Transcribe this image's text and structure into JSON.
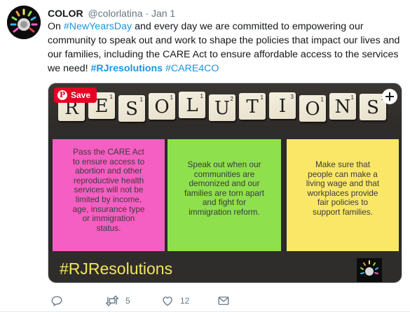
{
  "tweet": {
    "author_name": "COLOR",
    "handle": "@colorlatina",
    "separator": "·",
    "date": "Jan 1",
    "text": {
      "part1": "On ",
      "tag1": "#NewYearsDay",
      "part2": " and every day we are committed to empowering our community to speak out and work to shape the policies that impact our lives and our families, including the CARE Act to ensure affordable access to the services we need! ",
      "tag2": "#RJresolutions",
      "part3": " ",
      "tag3": "#CARE4CO"
    }
  },
  "image": {
    "save_label": "Save",
    "pin_logo": "P",
    "tiles": [
      {
        "letter": "R",
        "score": "1"
      },
      {
        "letter": "E",
        "score": "1"
      },
      {
        "letter": "S",
        "score": "1"
      },
      {
        "letter": "O",
        "score": "1"
      },
      {
        "letter": "L",
        "score": "1"
      },
      {
        "letter": "U",
        "score": "2"
      },
      {
        "letter": "T",
        "score": "1"
      },
      {
        "letter": "I",
        "score": "3"
      },
      {
        "letter": "O",
        "score": "1"
      },
      {
        "letter": "N",
        "score": "1"
      },
      {
        "letter": "S",
        "score": "1"
      }
    ],
    "notes": {
      "pink": "Pass the CARE Act to ensure access to abortion and other reproductive health services will not be limited by income, age, insurance type or immigration status.",
      "green": "Speak out when our communities are demonized and our families are torn apart and fight for immigration reform.",
      "yellow": "Make sure that people can make a living wage and that workplaces provide fair policies to support families."
    },
    "hashtag": "#RJResolutions",
    "colors": {
      "pink": "#f55ec2",
      "green": "#8ee04d",
      "yellow": "#fae767",
      "hashtag": "#f2e55e"
    }
  },
  "actions": {
    "reply_count": "",
    "retweet_count": "5",
    "like_count": "12"
  },
  "colors": {
    "link": "#1b95e0",
    "muted": "#657786",
    "pinterest": "#e60023"
  }
}
